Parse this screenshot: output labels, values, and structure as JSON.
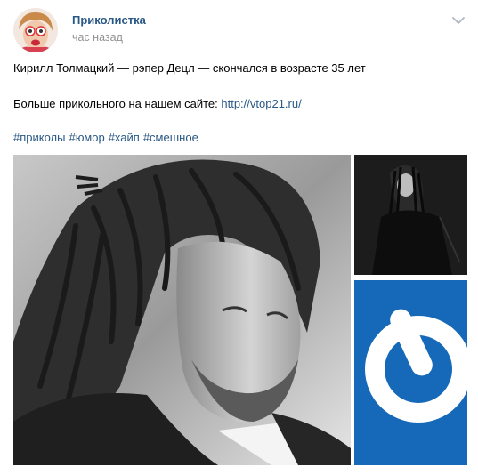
{
  "post": {
    "author": "Приколистка",
    "time": "час назад",
    "text_line1": "Кирилл Толмацкий — рэпер Децл — скончался в возрасте 35 лет",
    "text_line2_prefix": "Больше прикольного на нашем сайте: ",
    "text_link": "http://vtop21.ru/",
    "hashtags": [
      "#приколы",
      "#юмор",
      "#хайп",
      "#смешное"
    ]
  },
  "icons": {
    "menu": "chevron-down-icon",
    "logo": "power-logo"
  },
  "colors": {
    "link": "#2a5885",
    "muted": "#939393",
    "logo_blue": "#1669b8"
  }
}
